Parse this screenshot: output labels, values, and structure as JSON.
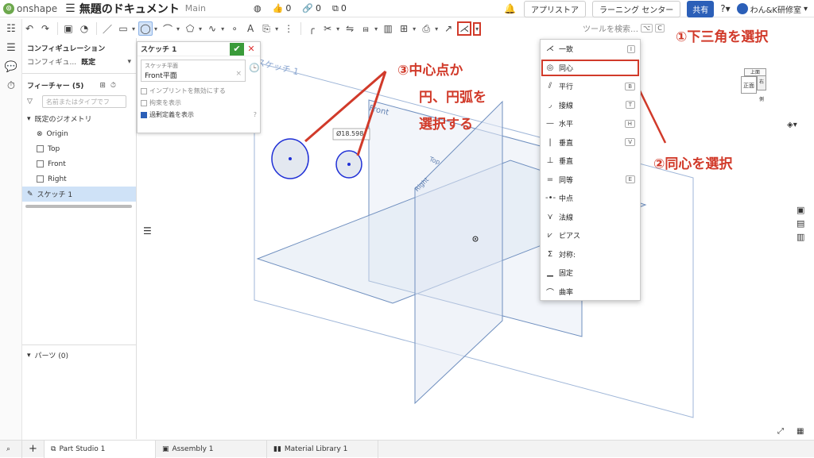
{
  "app": {
    "logo_text": "onshape",
    "doc_title": "無題のドキュメント",
    "workspace": "Main",
    "likes": "0",
    "links": "0",
    "copies": "0"
  },
  "topright": {
    "app_store": "アプリストア",
    "learning": "ラーニング センター",
    "share": "共有",
    "user": "わん&K研修室"
  },
  "toolbar": {
    "search_label": "ツールを検索…",
    "search_kbd1": "⌥",
    "search_kbd2": "C"
  },
  "panel": {
    "config_title": "コンフィギュレーション",
    "config_label": "コンフィギュ...",
    "config_value": "既定",
    "features_title": "フィーチャー (5)",
    "search_placeholder": "名前またはタイプでフ",
    "tree": [
      "既定のジオメトリ",
      "Origin",
      "Top",
      "Front",
      "Right",
      "スケッチ 1"
    ],
    "parts_title": "パーツ (0)"
  },
  "sketch_dialog": {
    "title": "スケッチ 1",
    "plane_label": "スケッチ平面",
    "plane_value": "Front平面",
    "checks": [
      "インプリントを無効にする",
      "拘束を表示",
      "過剰定義を表示"
    ]
  },
  "viewport": {
    "sketch_label": "スケッチ 1",
    "front_label": "Front",
    "top_label": "Top",
    "right_label": "Right",
    "dim_label": "Ø18.598",
    "view_front": "正面",
    "view_right": "右側",
    "view_top": "上面"
  },
  "constraint_menu": [
    {
      "label": "一致",
      "key": "I"
    },
    {
      "label": "同心",
      "key": ""
    },
    {
      "label": "平行",
      "key": "B"
    },
    {
      "label": "接線",
      "key": "T"
    },
    {
      "label": "水平",
      "key": "H"
    },
    {
      "label": "垂直",
      "key": "V"
    },
    {
      "label": "垂直",
      "key": ""
    },
    {
      "label": "同等",
      "key": "E"
    },
    {
      "label": "中点",
      "key": ""
    },
    {
      "label": "法線",
      "key": ""
    },
    {
      "label": "ピアス",
      "key": ""
    },
    {
      "label": "対称:",
      "key": ""
    },
    {
      "label": "固定",
      "key": ""
    },
    {
      "label": "曲率",
      "key": ""
    }
  ],
  "annotations": {
    "step1": "①下三角を選択",
    "step2": "②同心を選択",
    "step3_line1": "③中心点か",
    "step3_line2": "円、円弧を",
    "step3_line3": "選択する"
  },
  "tabs": [
    "Part Studio 1",
    "Assembly 1",
    "Material Library 1"
  ],
  "colors": {
    "annotation_red": "#d13a2a",
    "share_blue": "#2b5fb8",
    "plane_blue": "#6f8fbf",
    "circle_blue": "#1f2fd6"
  }
}
